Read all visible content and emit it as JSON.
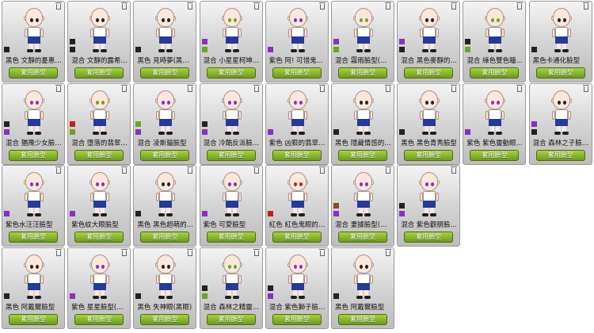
{
  "apply_label": "套用臉型",
  "colors": {
    "black": "#222222",
    "purple": "#8a2fc1",
    "green": "#6aa524",
    "red": "#c21f1f",
    "brown": "#8b4a2b"
  },
  "cards": [
    {
      "name": "黑色 文靜的憂惠…",
      "swatches": [
        "#222222"
      ]
    },
    {
      "name": "混合 文靜的露希…",
      "swatches": [
        "#222222",
        "#222222"
      ]
    },
    {
      "name": "黑色 見時夢(黑…",
      "swatches": [
        "#222222"
      ]
    },
    {
      "name": "混合 小星星柯坤…",
      "swatches": [
        "#8a2fc1",
        "#6aa524"
      ]
    },
    {
      "name": "紫色 阿! 可惜鬼…",
      "swatches": [
        "#8a2fc1"
      ]
    },
    {
      "name": "混合 霧雨臉型(…",
      "swatches": [
        "#8a2fc1",
        "#6aa524"
      ]
    },
    {
      "name": "混合 黑色麥靜的…",
      "swatches": [
        "#8a2fc1",
        "#222222"
      ]
    },
    {
      "name": "混合 綠色雙色瞳…",
      "swatches": [
        "#222222",
        "#6aa524"
      ]
    },
    {
      "name": "黑色卡通化臉型",
      "swatches": [
        "#222222"
      ]
    },
    {
      "name": "混合 猶豫少女臉…",
      "swatches": [
        "#222222",
        "#8a2fc1"
      ]
    },
    {
      "name": "混合 墮落的翡翠…",
      "swatches": [
        "#c21f1f",
        "#6aa524"
      ]
    },
    {
      "name": "混合 凌斯貓臉型",
      "swatches": [
        "#6aa524",
        "#8a2fc1"
      ]
    },
    {
      "name": "混合 冷酷反派臉…",
      "swatches": [
        "#222222",
        "#8a2fc1"
      ]
    },
    {
      "name": "紫色 凶狠的翡翠…",
      "swatches": [
        "#8a2fc1"
      ]
    },
    {
      "name": "黑色 隱藏情感的…",
      "swatches": [
        "#222222"
      ]
    },
    {
      "name": "黑色 黑色青秀臉型",
      "swatches": [
        "#222222"
      ]
    },
    {
      "name": "紫色 紫色靈動眼…",
      "swatches": [
        "#8a2fc1"
      ]
    },
    {
      "name": "混合 森林之子臉…",
      "swatches": [
        "#8a2fc1",
        "#222222"
      ]
    },
    {
      "name": "紫色水汪汪臉型",
      "swatches": [
        "#8a2fc1"
      ]
    },
    {
      "name": "紫色紋大眼臉型",
      "swatches": [
        "#8a2fc1"
      ]
    },
    {
      "name": "黑色 黑色超萌的…",
      "swatches": [
        "#222222"
      ]
    },
    {
      "name": "紫色 可愛臉型",
      "swatches": [
        "#8a2fc1"
      ]
    },
    {
      "name": "紅色 紅色鬼眼的…",
      "swatches": [
        "#c21f1f"
      ]
    },
    {
      "name": "混合 妻據臉型(…",
      "swatches": [
        "#8b4a2b",
        "#8a2fc1"
      ]
    },
    {
      "name": "混合 紫色觀朋臉…",
      "swatches": [
        "#222222",
        "#8a2fc1"
      ]
    },
    {
      "name": "黑色 阿戴爾臉型",
      "swatches": [
        "#222222"
      ]
    },
    {
      "name": "紫色 星星臉型(…",
      "swatches": [
        "#8a2fc1"
      ]
    },
    {
      "name": "黑色 失神眼(黑眼)",
      "swatches": [
        "#222222"
      ]
    },
    {
      "name": "混合 森林之精靈…",
      "swatches": [
        "#222222",
        "#6aa524"
      ]
    },
    {
      "name": "混合 紫色獅子臉…",
      "swatches": [
        "#222222",
        "#8a2fc1"
      ]
    },
    {
      "name": "黑色 阿戴爾臉型",
      "swatches": [
        "#222222"
      ]
    }
  ]
}
